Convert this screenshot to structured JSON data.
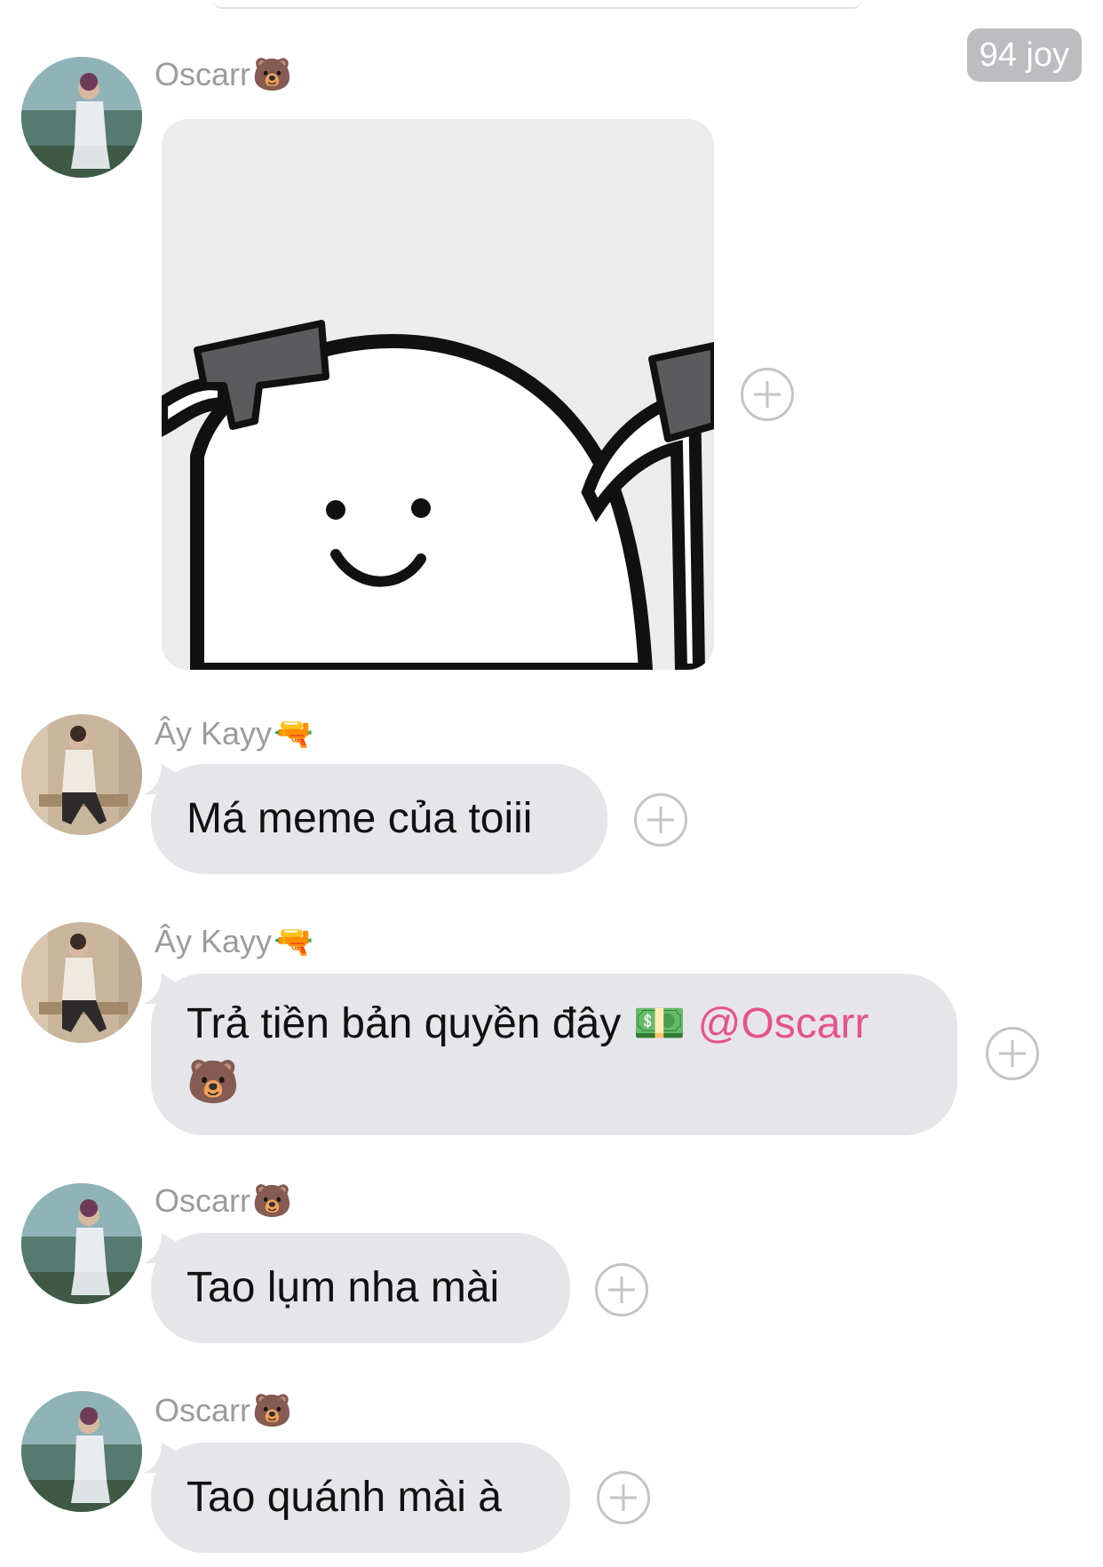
{
  "header": {
    "reaction_badge": "94 joy"
  },
  "messages": [
    {
      "sender": "Oscarr",
      "sender_emoji": "🐻",
      "type": "image",
      "image_desc": "meme"
    },
    {
      "sender": "Ây Kayy",
      "sender_emoji": "🔫",
      "type": "text",
      "text": "Má meme của toiii"
    },
    {
      "sender": "Ây Kayy",
      "sender_emoji": "🔫",
      "type": "text",
      "text_part1": "Trả tiền bản quyền đây",
      "money_emoji": "💵",
      "mention": "@Oscarr",
      "mention_emoji": "🐻"
    },
    {
      "sender": "Oscarr",
      "sender_emoji": "🐻",
      "type": "text",
      "text": "Tao lụm nha mài"
    },
    {
      "sender": "Oscarr",
      "sender_emoji": "🐻",
      "type": "text",
      "text": "Tao quánh mài à"
    }
  ],
  "colors": {
    "bubble_bg": "#e5e5ea",
    "mention": "#e6538a",
    "sender_name": "#9b9ba0",
    "badge_bg": "#bdbdc1"
  },
  "icons": [
    "add-reaction-icon",
    "bear-emoji",
    "water-pistol-emoji",
    "money-emoji"
  ]
}
